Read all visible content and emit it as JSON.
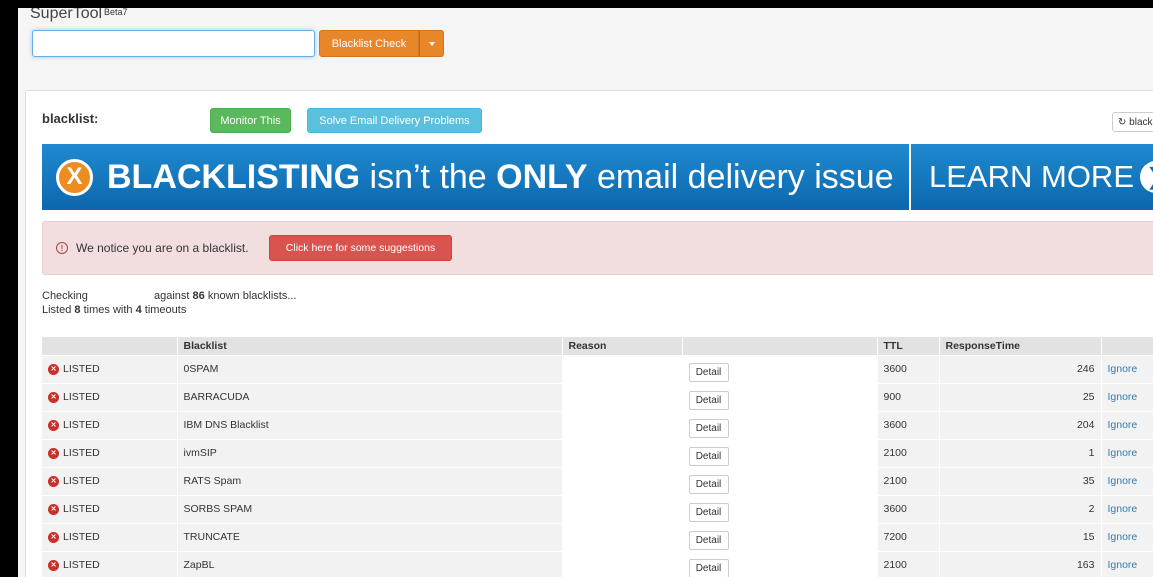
{
  "header": {
    "brand": "SuperTool",
    "beta": "Beta7",
    "search_value": "",
    "check_label": "Blacklist Check"
  },
  "panel": {
    "title": "blacklist:",
    "monitor_label": "Monitor This",
    "solve_label": "Solve Email Delivery Problems",
    "refresh_label": "blacklist"
  },
  "banner": {
    "x_glyph": "X",
    "word1": "BLACKLISTING",
    "word2": " isn’t the ",
    "word3": "ONLY",
    "word4": " email delivery issue",
    "cta": "LEARN MORE",
    "cta_arrow": "❯"
  },
  "alert": {
    "text": "We notice you are on a blacklist.",
    "button": "Click here for some suggestions"
  },
  "summary": {
    "checking": "Checking",
    "against": "against",
    "count": "86",
    "known": "known blacklists...",
    "listed_prefix": "Listed",
    "listed_count": "8",
    "times_with": "times with",
    "timeouts_count": "4",
    "timeouts": "timeouts"
  },
  "table": {
    "headers": [
      "",
      "Blacklist",
      "Reason",
      "",
      "TTL",
      "ResponseTime",
      ""
    ],
    "detail_label": "Detail",
    "ignore_label": "Ignore",
    "rows": [
      {
        "status": "LISTED",
        "blacklist": "0SPAM",
        "ttl": "3600",
        "response": "246"
      },
      {
        "status": "LISTED",
        "blacklist": "BARRACUDA",
        "ttl": "900",
        "response": "25"
      },
      {
        "status": "LISTED",
        "blacklist": "IBM DNS Blacklist",
        "ttl": "3600",
        "response": "204"
      },
      {
        "status": "LISTED",
        "blacklist": "ivmSIP",
        "ttl": "2100",
        "response": "1"
      },
      {
        "status": "LISTED",
        "blacklist": "RATS Spam",
        "ttl": "2100",
        "response": "35"
      },
      {
        "status": "LISTED",
        "blacklist": "SORBS SPAM",
        "ttl": "3600",
        "response": "2"
      },
      {
        "status": "LISTED",
        "blacklist": "TRUNCATE",
        "ttl": "7200",
        "response": "15"
      },
      {
        "status": "LISTED",
        "blacklist": "ZapBL",
        "ttl": "2100",
        "response": "163"
      }
    ]
  },
  "colors": {
    "orange": "#e8862a",
    "green": "#5cb85c",
    "blue": "#5bc0de",
    "red": "#d9534f",
    "banner": "#0c67ad",
    "link": "#337ab7"
  }
}
